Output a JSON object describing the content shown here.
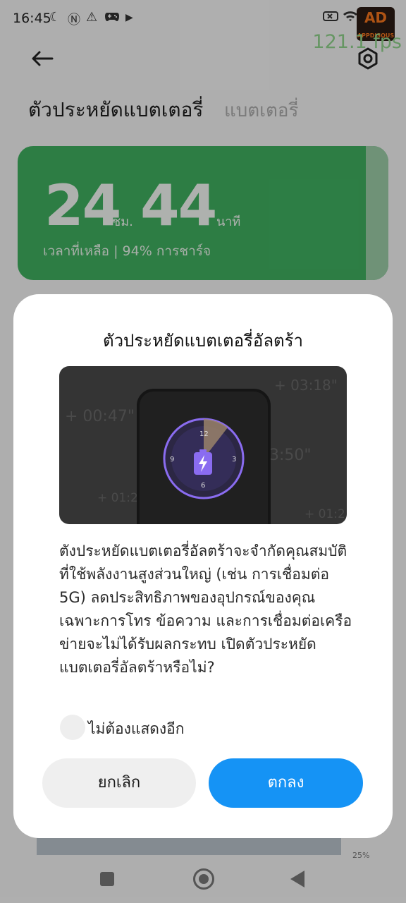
{
  "status_bar": {
    "time": "16:45",
    "left_icons": [
      "moon-icon",
      "nfc-icon",
      "warning-icon",
      "gamepad-icon",
      "play-icon"
    ],
    "right_icons": [
      "battery-x-icon",
      "wifi-icon"
    ],
    "fps": "121.1 fps",
    "logo_text": "AD",
    "logo_subtext": "APPDISQUS"
  },
  "header": {
    "tab_active": "ตัวประหยัดแบตเตอรี่",
    "tab_inactive": "แบตเตอรี่"
  },
  "battery_card": {
    "hours": "24",
    "hours_unit": "ชม.",
    "minutes": "44",
    "minutes_unit": "นาที",
    "remaining_text": "เวลาที่เหลือ | 94% การชาร์จ",
    "color": "#3fae5f"
  },
  "dialog": {
    "title": "ตัวประหยัดแบตเตอรี่อัลตร้า",
    "illustration": {
      "timers": [
        "+ 03:18\"",
        "+ 00:47\"",
        "3:50\"",
        "+ 01:2",
        "+ 01:2"
      ],
      "clock_numbers": [
        "12",
        "3",
        "6",
        "9"
      ]
    },
    "description": "ตังประหยัดแบตเตอรี่อัลตร้าจะจำกัดคุณสมบัติที่ใช้พลังงานสูงส่วนใหญ่ (เช่น การเชื่อมต่อ 5G) ลดประสิทธิภาพของอุปกรณ์ของคุณ เฉพาะการโทร ข้อความ และการเชื่อมต่อเครือข่ายจะไม่ได้รับผลกระทบ เปิดตัวประหยัดแบตเตอรี่อัลตร้าหรือไม่?",
    "checkbox_label": "ไม่ต้องแสดงอีก",
    "checkbox_checked": false,
    "cancel_label": "ยกเลิก",
    "ok_label": "ตกลง",
    "ok_color": "#1593f5"
  },
  "background_peek": {
    "percent_label": "25%"
  },
  "nav_bar": {
    "items": [
      "recents-button",
      "home-button",
      "back-button"
    ]
  }
}
